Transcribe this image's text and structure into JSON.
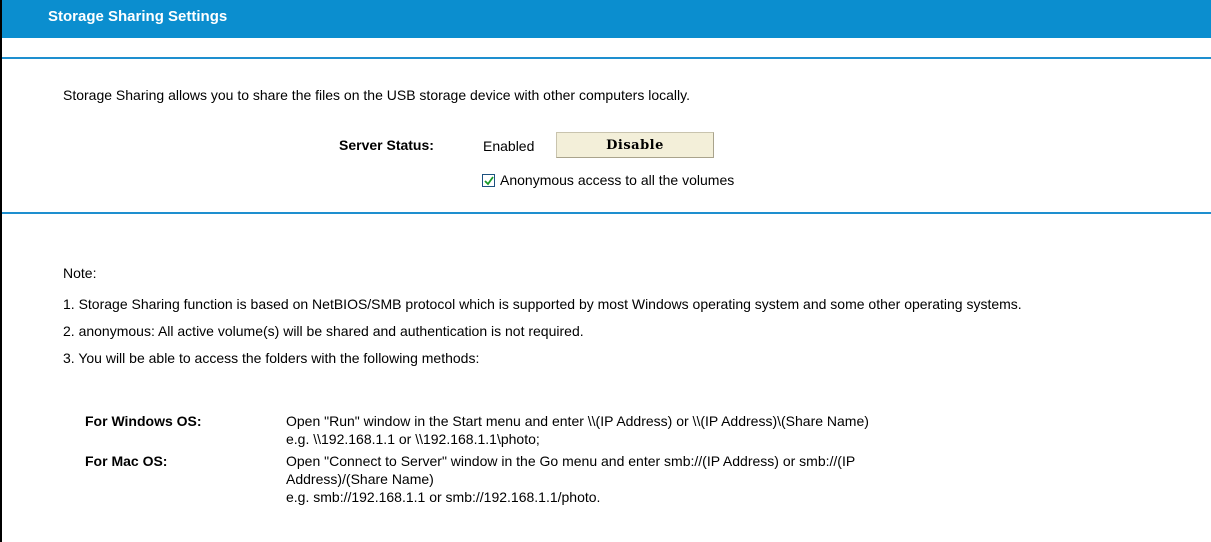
{
  "header": {
    "title": "Storage Sharing Settings"
  },
  "intro": "Storage Sharing allows you to share the files on the USB storage device with other computers locally.",
  "server": {
    "status_label": "Server Status:",
    "status_value": "Enabled",
    "toggle_button": "Disable",
    "anonymous_checked": true,
    "anonymous_label": "Anonymous access to all the volumes"
  },
  "notes": {
    "heading": "Note:",
    "items": [
      "1. Storage Sharing function is based on NetBIOS/SMB protocol which is supported by most Windows operating system and some other operating systems.",
      "2. anonymous: All active volume(s) will be shared and authentication is not required.",
      "3. You will be able to access the folders with the following methods:"
    ]
  },
  "methods": [
    {
      "os": "For Windows OS:",
      "lines": [
        "Open \"Run\" window in the Start menu and enter \\\\(IP Address) or \\\\(IP Address)\\(Share Name)",
        "e.g. \\\\192.168.1.1 or \\\\192.168.1.1\\photo;"
      ]
    },
    {
      "os": "For Mac OS:",
      "lines": [
        "Open \"Connect to Server\" window in the Go menu and enter smb://(IP Address) or smb://(IP",
        "Address)/(Share Name)",
        "e.g. smb://192.168.1.1 or smb://192.168.1.1/photo."
      ]
    }
  ],
  "colors": {
    "title_bar": "#0b8ecf",
    "divider": "#1e8fcf",
    "button_bg": "#f3efd9"
  }
}
